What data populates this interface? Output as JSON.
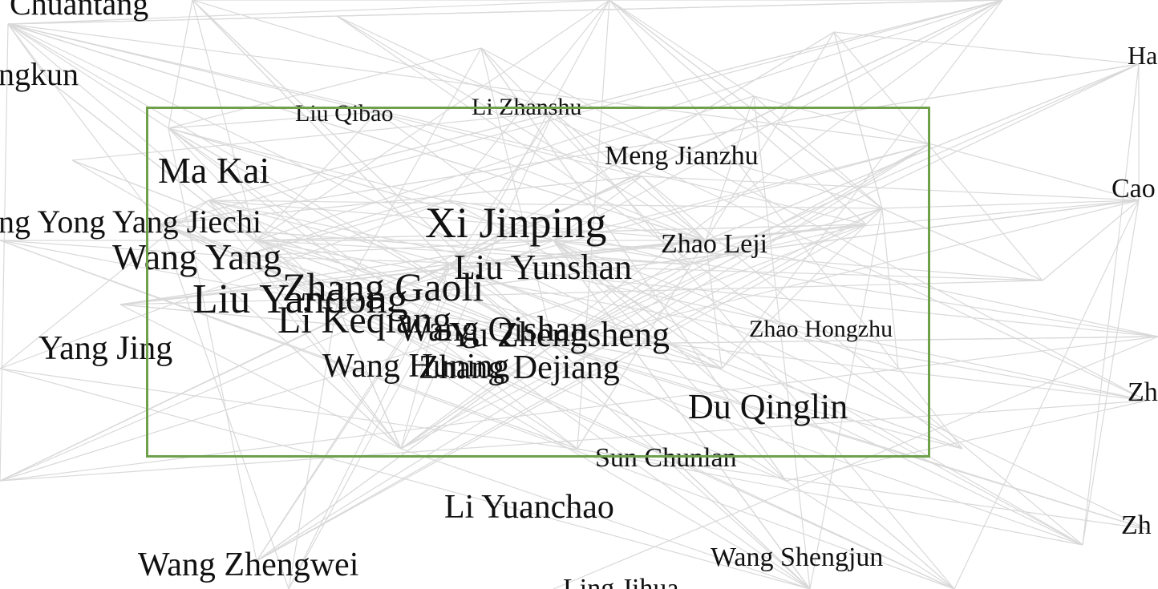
{
  "colors": {
    "edge": "#d9d9d9",
    "label": "#111111",
    "selection": "#6fa04a",
    "background": "#ffffff"
  },
  "nodes": [
    {
      "id": "chuantang",
      "label": "Chuantang"
    },
    {
      "id": "gkun",
      "label": "ngkun"
    },
    {
      "id": "liu-qibao",
      "label": "Liu Qibao"
    },
    {
      "id": "li-zhanshu",
      "label": "Li Zhanshu"
    },
    {
      "id": "ha",
      "label": "Ha"
    },
    {
      "id": "ma-kai",
      "label": "Ma Kai"
    },
    {
      "id": "meng-jianzhu",
      "label": "Meng Jianzhu"
    },
    {
      "id": "cao",
      "label": "Cao"
    },
    {
      "id": "yong",
      "label": "ng Yong"
    },
    {
      "id": "yang-jiechi",
      "label": "Yang Jiechi"
    },
    {
      "id": "xi-jinping",
      "label": "Xi Jinping"
    },
    {
      "id": "zhao-leji",
      "label": "Zhao Leji"
    },
    {
      "id": "wang-yang",
      "label": "Wang Yang"
    },
    {
      "id": "liu-yunshan",
      "label": "Liu Yunshan"
    },
    {
      "id": "zhang-gaoli",
      "label": "Zhang Gaoli"
    },
    {
      "id": "liu-yandong",
      "label": "Liu Yandong"
    },
    {
      "id": "li-keqiang",
      "label": "Li Keqiang"
    },
    {
      "id": "wang-qishan",
      "label": "Wang Qishan"
    },
    {
      "id": "yu-zhengsheng",
      "label": "Yu Zhengsheng"
    },
    {
      "id": "zhao-hongzhu",
      "label": "Zhao Hongzhu"
    },
    {
      "id": "yang-jing",
      "label": "Yang Jing"
    },
    {
      "id": "wang-huning",
      "label": "Wang Huning"
    },
    {
      "id": "zhang-dejiang",
      "label": "Zhang Dejiang"
    },
    {
      "id": "zh-1",
      "label": "Zh"
    },
    {
      "id": "du-qinglin",
      "label": "Du Qinglin"
    },
    {
      "id": "sun-chunlan",
      "label": "Sun Chunlan"
    },
    {
      "id": "li-yuanchao",
      "label": "Li Yuanchao"
    },
    {
      "id": "zh-2",
      "label": "Zh"
    },
    {
      "id": "wang-zhengwei",
      "label": "Wang Zhengwei"
    },
    {
      "id": "wang-shengjun",
      "label": "Wang Shengjun"
    },
    {
      "id": "ling-jihua",
      "label": "Ling Jihua"
    }
  ]
}
